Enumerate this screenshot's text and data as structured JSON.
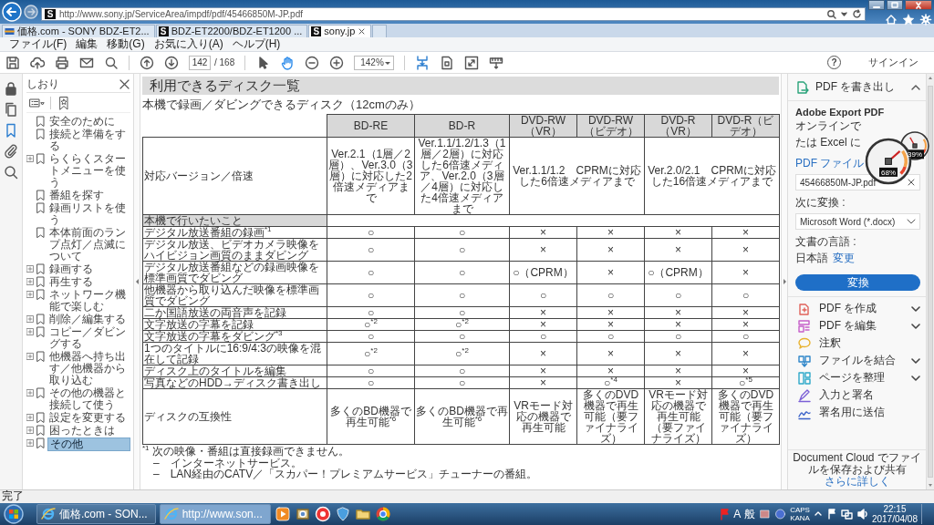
{
  "browser": {
    "site_icon": "S",
    "url": "http://www.sony.jp/ServiceArea/impdf/pdf/45466850M-JP.pdf",
    "tabs": [
      {
        "label": "価格.com - SONY BDZ-ET2...",
        "selected": false
      },
      {
        "label": "BDZ-ET2200/BDZ-ET1200 ...",
        "icon_text": "S",
        "selected": false
      },
      {
        "label": "sony.jp",
        "icon_text": "S",
        "selected": true
      }
    ],
    "menu": [
      "ファイル(F)",
      "編集",
      "移動(G)",
      "お気に入り(A)",
      "ヘルプ(H)"
    ]
  },
  "toolbar": {
    "page": "142",
    "page_count": "/ 168",
    "zoom": "142%",
    "help": "?",
    "sign_in": "サインイン",
    "tools": [
      {
        "selected": false
      },
      {
        "selected": true
      }
    ]
  },
  "side_tools": [
    {
      "selected": false
    },
    {
      "selected": false
    },
    {
      "selected": true
    },
    {
      "selected": false
    },
    {
      "selected": false
    }
  ],
  "sidebar": {
    "title": "しおり",
    "bookmarks": [
      {
        "label": "安全のために",
        "expandable": false,
        "selected": false
      },
      {
        "label": "接続と準備をする",
        "expandable": false,
        "selected": false
      },
      {
        "label": "らくらくスタートメニューを使う",
        "expandable": true,
        "selected": false
      },
      {
        "label": "番組を探す",
        "expandable": false,
        "selected": false
      },
      {
        "label": "録画リストを使う",
        "expandable": false,
        "selected": false
      },
      {
        "label": "本体前面のランプ点灯／点滅について",
        "expandable": false,
        "selected": false
      },
      {
        "label": "録画する",
        "expandable": true,
        "selected": false
      },
      {
        "label": "再生する",
        "expandable": true,
        "selected": false
      },
      {
        "label": "ネットワーク機能で楽しむ",
        "expandable": true,
        "selected": false
      },
      {
        "label": "削除／編集する",
        "expandable": true,
        "selected": false
      },
      {
        "label": "コピー／ダビングする",
        "expandable": true,
        "selected": false
      },
      {
        "label": "他機器へ持ち出す／他機器から取り込む",
        "expandable": true,
        "selected": false
      },
      {
        "label": "その他の機器と接続して使う",
        "expandable": true,
        "selected": false
      },
      {
        "label": "設定を変更する",
        "expandable": true,
        "selected": false
      },
      {
        "label": "困ったときは",
        "expandable": true,
        "selected": false
      },
      {
        "label": "その他",
        "expandable": true,
        "selected": true
      }
    ]
  },
  "document": {
    "title": "利用できるディスク一覧",
    "subtitle": "本機で録画／ダビングできるディスク（12cmのみ）",
    "table": {
      "columns": [
        "BD-RE",
        "BD-R",
        "DVD-RW（VR）",
        "DVD-RW（ビデオ）",
        "DVD-R（VR）",
        "DVD-R（ビデオ）"
      ],
      "version_label": "対応バージョン／倍速",
      "versions": [
        {
          "text": "Ver.2.1（1層／2層）、Ver.3.0（3層）に対応した2倍速メディアまで",
          "wide": false
        },
        {
          "text": "Ver.1.1/1.2/1.3（1層／2層）に対応した6倍速メディア、Ver.2.0（3層／4層）に対応した4倍速メディアまで",
          "wide": false
        },
        {
          "text": "Ver.1.1/1.2　CPRMに対応した6倍速メディアまで",
          "wide": true
        },
        {
          "text": "Ver.2.0/2.1　CPRMに対応した16倍速メディアまで",
          "wide": true
        }
      ],
      "section": "本機で行いたいこと",
      "rows": [
        {
          "label": "デジタル放送番組の録画$^{*1}$",
          "cells": [
            "○",
            "○",
            "×",
            "×",
            "×",
            "×"
          ]
        },
        {
          "label": "デジタル放送、ビデオカメラ映像をハイビジョン画質のままダビング",
          "cells": [
            "○",
            "○",
            "×",
            "×",
            "×",
            "×"
          ]
        },
        {
          "label": "デジタル放送番組などの録画映像を標準画質でダビング",
          "cells": [
            "○",
            "○",
            "○（CPRM）",
            "×",
            "○（CPRM）",
            "×"
          ]
        },
        {
          "label": "他機器から取り込んだ映像を標準画質でダビング",
          "cells": [
            "○",
            "○",
            "○",
            "○",
            "○",
            "○"
          ]
        },
        {
          "label": "二か国語放送の両音声を記録",
          "cells": [
            "○",
            "○",
            "×",
            "×",
            "×",
            "×"
          ]
        },
        {
          "label": "文字放送の字幕を記録",
          "cells": [
            "○$^{*2}$",
            "○$^{*2}$",
            "×",
            "×",
            "×",
            "×"
          ]
        },
        {
          "label": "文字放送の字幕をダビング$^{*3}$",
          "cells": [
            "○",
            "○",
            "○",
            "○",
            "○",
            "○"
          ]
        },
        {
          "label": "1つのタイトルに16:9/4:3の映像を混在して記録",
          "cells": [
            "○$^{*2}$",
            "○$^{*2}$",
            "×",
            "×",
            "×",
            "×"
          ]
        },
        {
          "label": "ディスク上のタイトルを編集",
          "cells": [
            "○",
            "○",
            "×",
            "×",
            "×",
            "×"
          ]
        },
        {
          "label": "写真などのHDD→ディスク書き出し",
          "cells": [
            "○",
            "○",
            "×",
            "○$^{*4}$",
            "×",
            "○$^{*5}$"
          ]
        },
        {
          "label": "ディスクの互換性",
          "cells": [
            "多くのBD機器で再生可能$^{*6}$",
            "多くのBD機器で再生可能$^{*6}$",
            "VRモード対応の機器で再生可能",
            "多くのDVD機器で再生可能（要ファイナライズ）",
            "VRモード対応の機器で再生可能（要ファイナライズ）",
            "多くのDVD機器で再生可能（要ファイナライズ）"
          ]
        }
      ]
    },
    "footnotes": [
      "$^{*1}$ 次の映像・番組は直接録画できません。",
      "–　インターネットサービス。",
      "–　LAN経由のCATV／「スカパー！プレミアムサービス」チューナーの番組。"
    ]
  },
  "export_panel": {
    "title": "PDF を書き出し",
    "heading": "Adobe Export PDF",
    "intro_lines": [
      "オンラインで",
      "たは Excel に"
    ],
    "file_label": "PDF ファイル",
    "file_name": "45466850M-JP.pdf",
    "convert_label": "次に変換 :",
    "format": "Microsoft Word (*.docx)",
    "language_label": "文書の言語 :",
    "language": "日本語",
    "change_link": "変更",
    "convert_button": "変換",
    "tools": [
      {
        "label": "PDF を作成",
        "expandable": true
      },
      {
        "label": "PDF を編集",
        "expandable": true
      },
      {
        "label": "注釈",
        "expandable": false
      },
      {
        "label": "ファイルを結合",
        "expandable": true
      },
      {
        "label": "ページを整理",
        "expandable": true
      },
      {
        "label": "入力と署名",
        "expandable": false
      },
      {
        "label": "署名用に送信",
        "expandable": false
      }
    ],
    "footer": "Document Cloud でファイルを保存および共有",
    "footer_link": "さらに詳しく"
  },
  "gadget": {
    "gauges": [
      {
        "reading": "68%",
        "level": 0.68
      },
      {
        "reading": "39%",
        "level": 0.39
      }
    ]
  },
  "status_bar": "完了",
  "taskbar": {
    "tasks": [
      {
        "label": "価格.com - SON...",
        "selected": false
      },
      {
        "label": "http://www.son...",
        "selected": true
      }
    ],
    "ime": [
      "A",
      "般"
    ],
    "keys": [
      "CAPS",
      "KANA"
    ],
    "time": "22:15",
    "date": "2017/04/08"
  }
}
